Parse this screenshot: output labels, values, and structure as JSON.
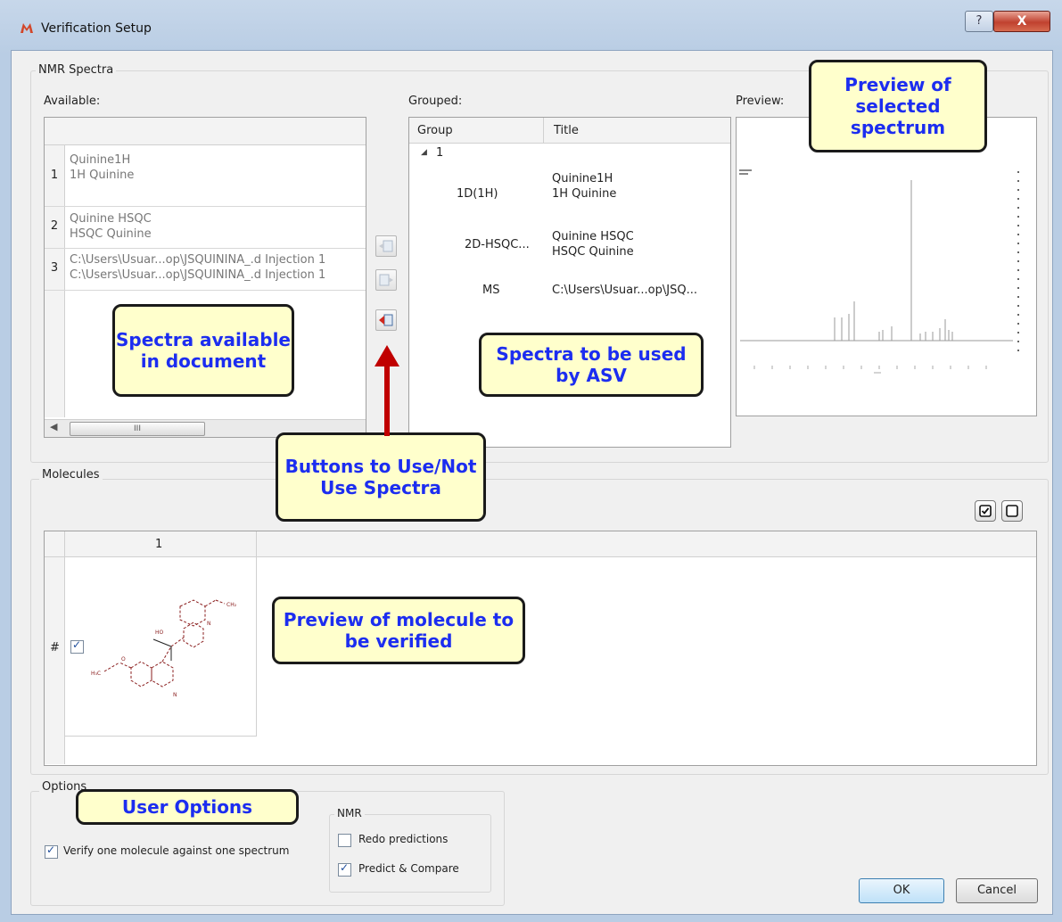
{
  "window": {
    "title": "Verification Setup",
    "help_glyph": "?",
    "close_glyph": "X"
  },
  "nmr_spectra": {
    "group_label": "NMR Spectra",
    "available": {
      "label": "Available:",
      "rows": [
        {
          "num": "1",
          "line1": "Quinine1H",
          "line2": "1H Quinine"
        },
        {
          "num": "2",
          "line1": "Quinine HSQC",
          "line2": "HSQC Quinine"
        },
        {
          "num": "3",
          "line1": "C:\\Users\\Usuar...op\\JSQUININA_.d Injection 1",
          "line2": "C:\\Users\\Usuar...op\\JSQUININA_.d Injection 1"
        }
      ],
      "scroll_grip": "III"
    },
    "grouped": {
      "label": "Grouped:",
      "col_group": "Group",
      "col_title": "Title",
      "tree_root": "1",
      "rows": [
        {
          "group": "1D(1H)",
          "title1": "Quinine1H",
          "title2": "1H Quinine"
        },
        {
          "group": "2D-HSQC...",
          "title1": "Quinine HSQC",
          "title2": "HSQC Quinine"
        },
        {
          "group": "MS",
          "title1": "C:\\Users\\Usuar...op\\JSQ...",
          "title2": ""
        }
      ]
    },
    "preview": {
      "label": "Preview:"
    }
  },
  "molecules": {
    "group_label": "Molecules",
    "column": "1",
    "row_marker": "#",
    "row_checked": true
  },
  "options": {
    "group_label": "Options",
    "verify_one": {
      "label": "Verify one molecule against one spectrum",
      "checked": true
    },
    "nmr": {
      "group_label": "NMR",
      "redo": {
        "label": "Redo predictions",
        "checked": false
      },
      "predict": {
        "label": "Predict & Compare",
        "checked": true
      }
    }
  },
  "buttons": {
    "ok": "OK",
    "cancel": "Cancel"
  },
  "callouts": {
    "preview_spectrum": "Preview of selected spectrum",
    "spectra_available": "Spectra available in document",
    "spectra_used": "Spectra to be used by ASV",
    "buttons_use": "Buttons to Use/Not Use Spectra",
    "preview_molecule": "Preview of molecule to be verified",
    "user_options": "User Options"
  },
  "colors": {
    "callout_bg": "#ffffcc",
    "callout_text": "#1c2df0",
    "arrow": "#c00000"
  }
}
